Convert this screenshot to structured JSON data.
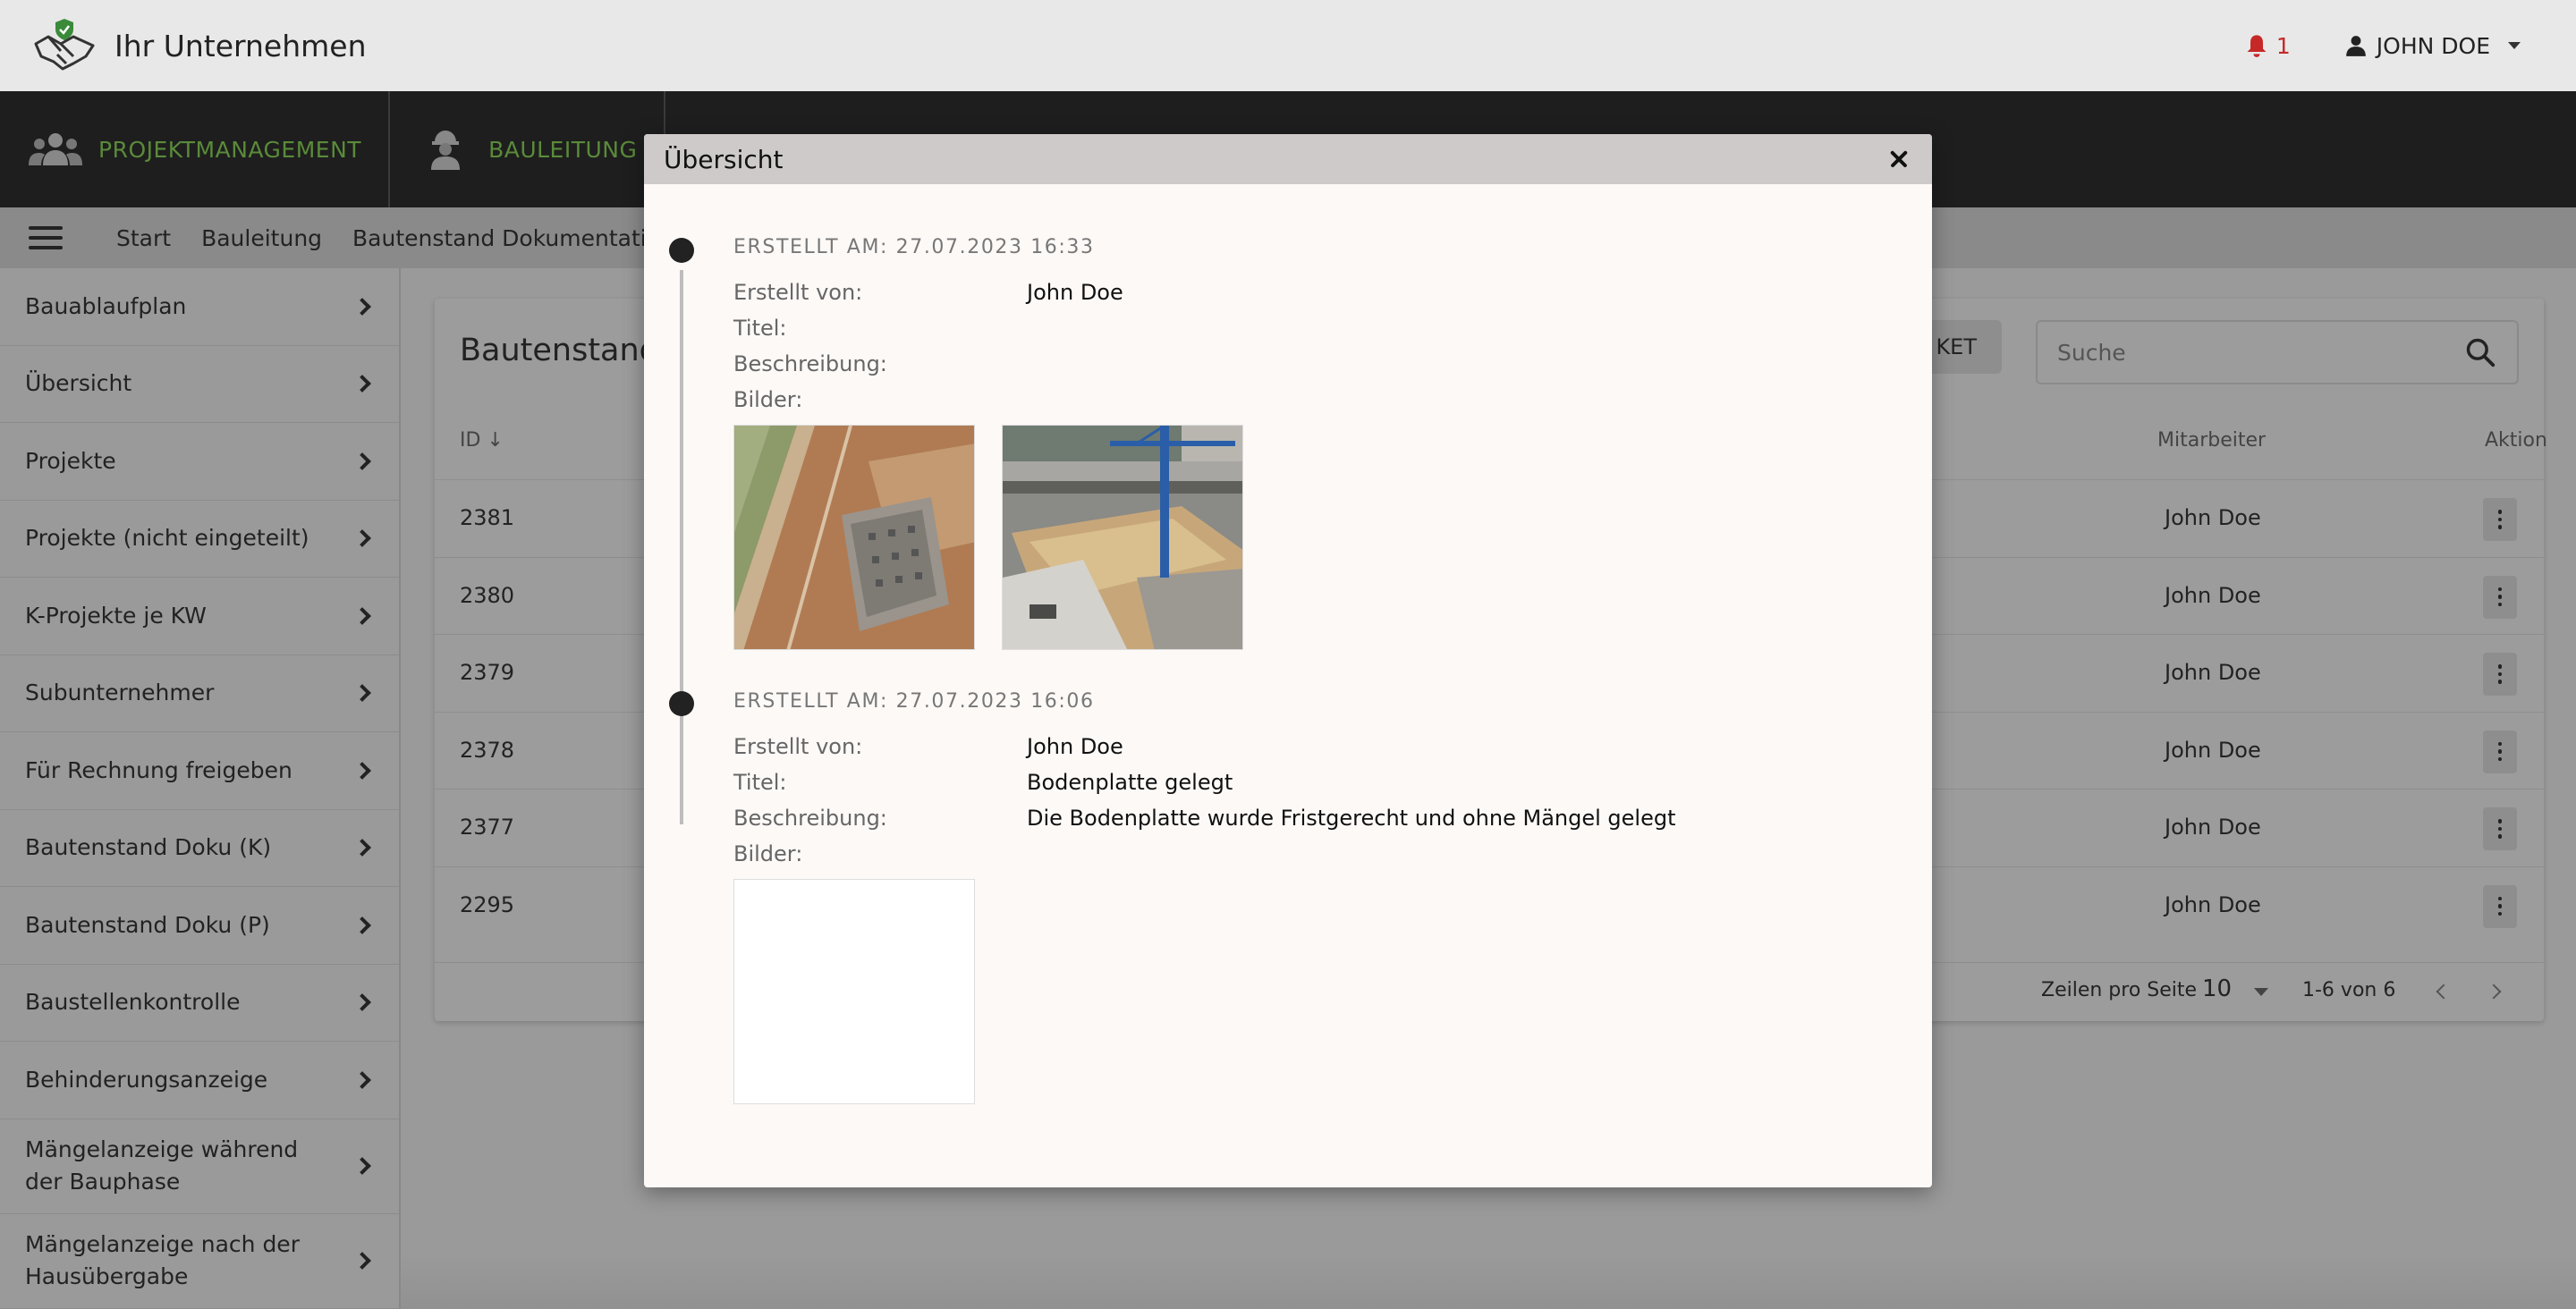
{
  "header": {
    "brand_name": "Ihr Unternehmen",
    "notification_count": "1",
    "user_name": "JOHN DOE"
  },
  "modules": [
    {
      "label": "PROJEKTMANAGEMENT",
      "icon": "team-icon"
    },
    {
      "label": "BAULEITUNG",
      "icon": "construction-worker-icon"
    }
  ],
  "breadcrumb": [
    "Start",
    "Bauleitung",
    "Bautenstand Dokumentation"
  ],
  "sidebar": {
    "items": [
      "Bauablaufplan",
      "Übersicht",
      "Projekte",
      "Projekte (nicht eingeteilt)",
      "K-Projekte je KW",
      "Subunternehmer",
      "Für Rechnung freigeben",
      "Bautenstand Doku (K)",
      "Bautenstand Doku (P)",
      "Baustellenkontrolle",
      "Behinderungsanzeige",
      "Mängelanzeige während der Bauphase",
      "Mängelanzeige nach der Hausübergabe"
    ]
  },
  "main": {
    "title": "Bautenstand",
    "button_fragment": "KET",
    "search_placeholder": "Suche",
    "columns": {
      "id": "ID",
      "employee": "Mitarbeiter",
      "action": "Aktion"
    },
    "rows": [
      {
        "id": "2381",
        "employee": "John Doe"
      },
      {
        "id": "2380",
        "employee": "John Doe"
      },
      {
        "id": "2379",
        "employee": "John Doe"
      },
      {
        "id": "2378",
        "employee": "John Doe"
      },
      {
        "id": "2377",
        "employee": "John Doe"
      },
      {
        "id": "2295",
        "employee": "John Doe"
      }
    ],
    "pagination": {
      "rows_per_page_label": "Zeilen pro Seite",
      "rows_per_page": "10",
      "range": "1-6 von 6"
    }
  },
  "modal": {
    "title": "Übersicht",
    "labels": {
      "created_by": "Erstellt von:",
      "title": "Titel:",
      "description": "Beschreibung:",
      "images": "Bilder:"
    },
    "entries": [
      {
        "date": "ERSTELLT AM: 27.07.2023 16:33",
        "created_by": "John Doe",
        "title": "",
        "description": "",
        "images": [
          "construction-site-foundation-photo",
          "construction-crane-building-photo"
        ]
      },
      {
        "date": "ERSTELLT AM: 27.07.2023 16:06",
        "created_by": "John Doe",
        "title": "Bodenplatte gelegt",
        "description": "Die Bodenplatte wurde Fristgerecht und ohne Mängel gelegt",
        "images": [
          "empty-image-placeholder"
        ]
      }
    ]
  },
  "colors": {
    "accent_green": "#5a8a3a",
    "notification_red": "#c62828",
    "module_bar": "#1e1e1e",
    "modal_header": "#cfcaca"
  }
}
